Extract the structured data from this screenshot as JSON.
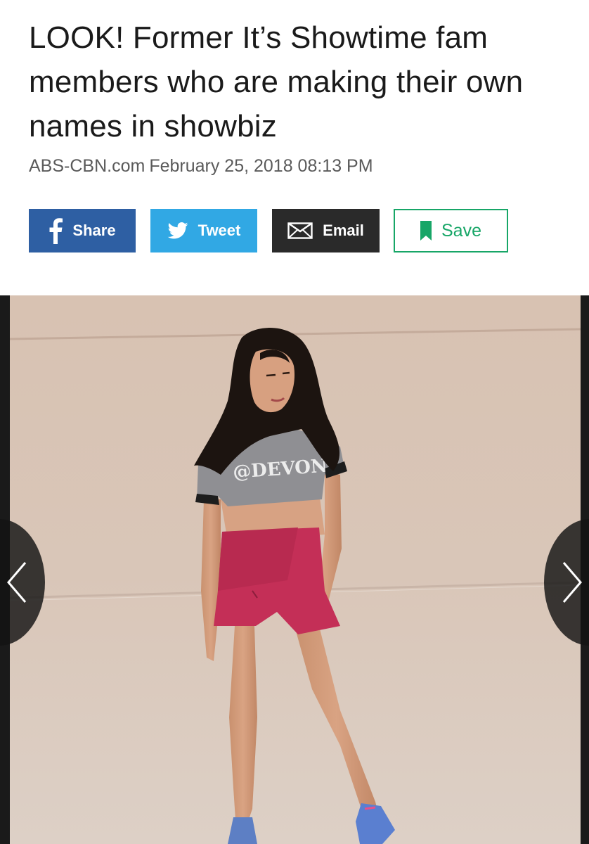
{
  "article": {
    "headline": "LOOK! Former It’s Showtime fam members who are making their own names in showbiz",
    "source": "ABS-CBN.com",
    "date": "February 25, 2018 08:13 PM"
  },
  "share_bar": {
    "share_label": "Share",
    "tweet_label": "Tweet",
    "email_label": "Email",
    "save_label": "Save",
    "icons": [
      "facebook-icon",
      "twitter-bird-icon",
      "envelope-icon",
      "bookmark-icon"
    ],
    "colors": {
      "share": "#2e5fa3",
      "tweet": "#31a8e4",
      "email": "#2a2a2a",
      "save": "#17a667"
    }
  },
  "gallery": {
    "shirt_text": "@DEVON",
    "prev_icon": "chevron-left-icon",
    "next_icon": "chevron-right-icon"
  }
}
